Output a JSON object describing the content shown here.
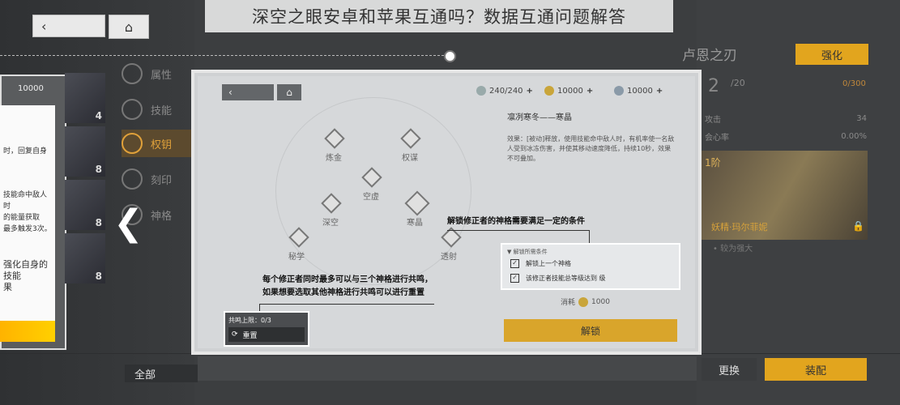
{
  "title_banner": "深空之眼安卓和苹果互通吗？数据互通问题解答",
  "top_nav": {
    "back_icon": "‹",
    "home_icon": "⌂"
  },
  "side_menu": {
    "items": [
      {
        "label": "属性",
        "icon": "star-icon",
        "active": false
      },
      {
        "label": "技能",
        "icon": "skill-icon",
        "active": false
      },
      {
        "label": "权钥",
        "icon": "key-icon",
        "active": true
      },
      {
        "label": "刻印",
        "icon": "imprint-icon",
        "active": false
      },
      {
        "label": "神格",
        "icon": "divinity-icon",
        "active": false
      }
    ],
    "all_button": "全部"
  },
  "left_panel": {
    "resource_value": "10000",
    "text_lines": [
      "时，回复自身",
      "技能命中敌人时",
      "的能量获取",
      "最多触发3次。",
      "强化自身的技能",
      "果"
    ]
  },
  "portraits": [
    "4",
    "8",
    "8",
    "8"
  ],
  "main_panel": {
    "resources": [
      {
        "value": "240/240"
      },
      {
        "value": "10000"
      },
      {
        "value": "10000"
      }
    ],
    "nodes": [
      {
        "label": "炼金"
      },
      {
        "label": "权谋"
      },
      {
        "label": "空虚"
      },
      {
        "label": "深空"
      },
      {
        "label": "寒晶"
      },
      {
        "label": "秘学"
      },
      {
        "label": "透射"
      }
    ],
    "desc_title": "凛冽寒冬——寒晶",
    "desc_body": "效果：[被动]释放，使用技能命中敌人时，有机率使一名敌人受到冰冻伤害，并使其移动速度降低，持续10秒，效果不可叠加。",
    "annotation_top": "解锁修正者的神格需要满足一定的条件",
    "annotation_bottom_1": "每个修正者同时最多可以与三个神格进行共鸣，",
    "annotation_bottom_2": "如果想要选取其他神格进行共鸣可以进行重置",
    "resonance_limit": "共鸣上限：0/3",
    "reset_label": "重置",
    "conditions_title": "▼ 解锁所需条件",
    "conditions": [
      {
        "text": "解锁上一个神格"
      },
      {
        "text": "该修正者技能总等级达到  级"
      }
    ],
    "cost_label": "消耗",
    "cost_value": "1000",
    "unlock_label": "解锁"
  },
  "right_panel": {
    "name": "卢恩之刃",
    "upgrade_label": "强化",
    "level": "2",
    "level_max": "/20",
    "exp": "0/300",
    "stats": [
      {
        "label": "攻击",
        "value": "34"
      },
      {
        "label": "会心率",
        "value": "0.00%"
      },
      {
        "label": "",
        "value": "0.00%"
      }
    ],
    "card_tier": "1阶",
    "card_name": "妖精·玛尔菲妮",
    "card_sub": "• 较为强大",
    "change_label": "更换",
    "equip_label": "装配"
  }
}
